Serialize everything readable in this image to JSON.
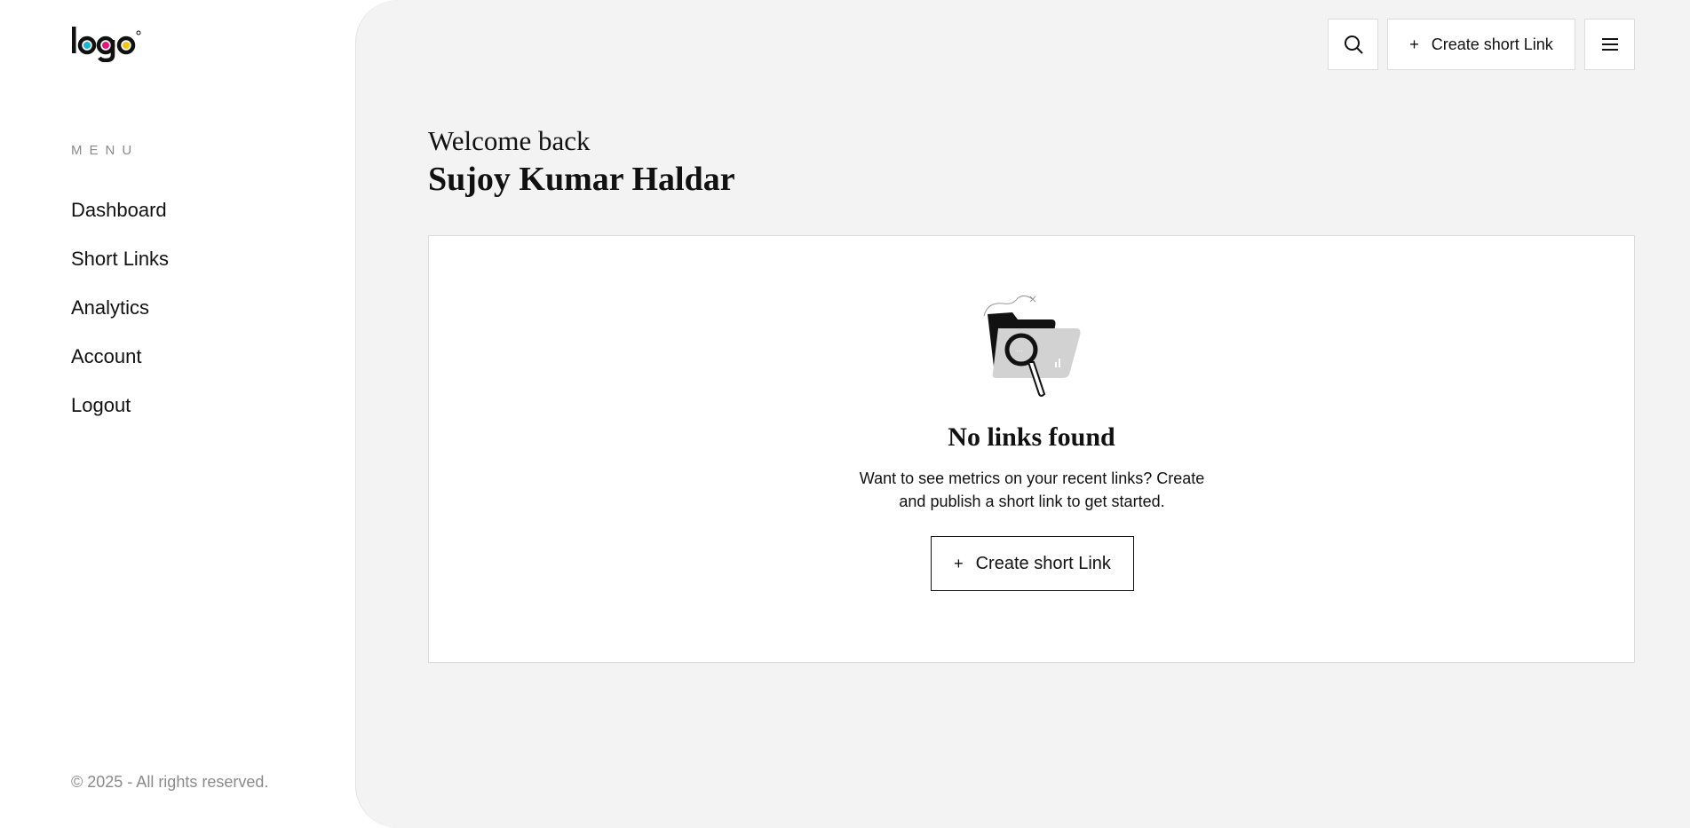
{
  "brand": {
    "logo_text": "logo",
    "colors": {
      "cyan": "#19b6d2",
      "magenta": "#e5157a",
      "yellow": "#f5c518"
    }
  },
  "sidebar": {
    "menu_heading": "MENU",
    "items": [
      {
        "label": "Dashboard"
      },
      {
        "label": "Short Links"
      },
      {
        "label": "Analytics"
      },
      {
        "label": "Account"
      },
      {
        "label": "Logout"
      }
    ],
    "copyright": "© 2025 - All rights reserved."
  },
  "topbar": {
    "search_icon": "search-icon",
    "create_label": "Create short Link",
    "menu_icon": "hamburger-menu-icon"
  },
  "header": {
    "greeting": "Welcome back",
    "user_name": "Sujoy Kumar Haldar"
  },
  "empty_state": {
    "illustration": "folder-magnifier-icon",
    "title": "No links found",
    "description": "Want to see metrics on your recent links? Create and publish a short link to get started.",
    "button_label": "Create short Link"
  }
}
